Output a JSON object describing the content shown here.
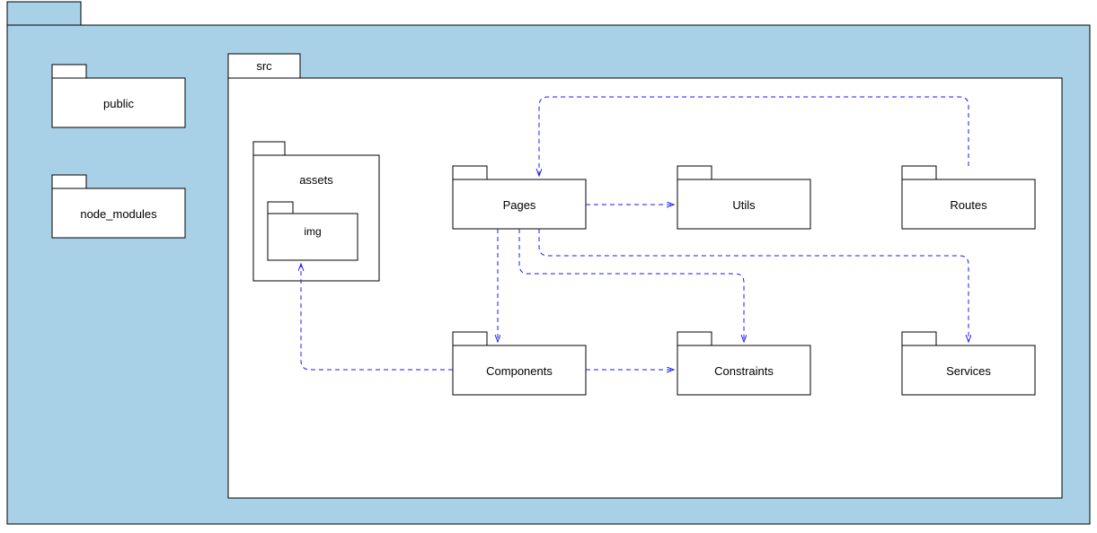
{
  "packages": {
    "public": "public",
    "node_modules": "node_modules",
    "src": "src",
    "assets": "assets",
    "img": "img",
    "pages": "Pages",
    "utils": "Utils",
    "routes": "Routes",
    "components": "Components",
    "constraints": "Constraints",
    "services": "Services"
  },
  "dependencies": [
    {
      "from": "Routes",
      "to": "Pages"
    },
    {
      "from": "Pages",
      "to": "Utils"
    },
    {
      "from": "Pages",
      "to": "Components"
    },
    {
      "from": "Pages",
      "to": "Constraints"
    },
    {
      "from": "Pages",
      "to": "Services"
    },
    {
      "from": "Components",
      "to": "Constraints"
    },
    {
      "from": "Components",
      "to": "img"
    }
  ],
  "colors": {
    "background": "#a8d0e6",
    "arrow": "#1a1aff",
    "box_fill": "#ffffff",
    "box_stroke": "#000000"
  }
}
